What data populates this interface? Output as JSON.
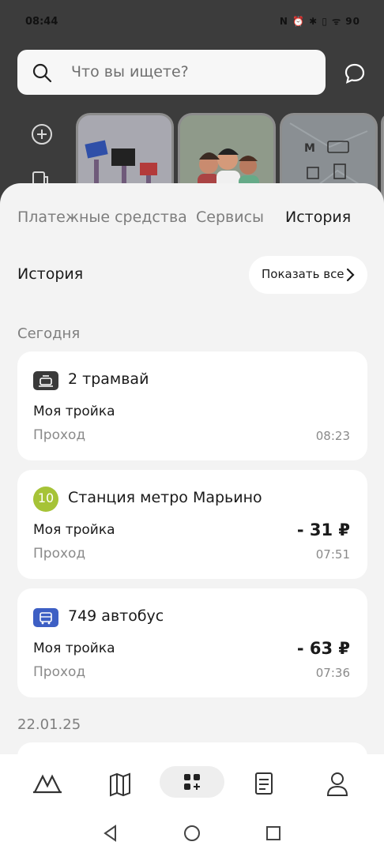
{
  "status_bar": {
    "time": "08:44",
    "icons_text": "N ⏰ ✱ ▯ ᯤ 90"
  },
  "search": {
    "placeholder": "Что вы ищете?"
  },
  "tabs": [
    {
      "label": "Платежные средства",
      "active": false
    },
    {
      "label": "Сервисы",
      "active": false
    },
    {
      "label": "История",
      "active": true
    }
  ],
  "history": {
    "title": "История",
    "show_all": "Показать все"
  },
  "groups": [
    {
      "date": "Сегодня",
      "items": [
        {
          "icon": "tram-icon",
          "badge_color": "#3a3a3a",
          "title": "2 трамвай",
          "line1": "Моя тройка",
          "line2": "Проход",
          "amount": "",
          "time": "08:23"
        },
        {
          "icon": "metro-line-10-icon",
          "badge_text": "10",
          "badge_color": "#a6c337",
          "title": "Станция метро Марьино",
          "line1": "Моя тройка",
          "line2": "Проход",
          "amount": "- 31 ₽",
          "time": "07:51"
        },
        {
          "icon": "bus-icon",
          "badge_color": "#3d5fc4",
          "title": "749 автобус",
          "line1": "Моя тройка",
          "line2": "Проход",
          "amount": "- 63 ₽",
          "time": "07:36"
        }
      ]
    },
    {
      "date": "22.01.25",
      "items": []
    }
  ],
  "bottom_nav": [
    "metro-logo-icon",
    "map-icon",
    "services-icon",
    "receipt-icon",
    "profile-icon"
  ],
  "colors": {
    "accent_metro": "#a6c337",
    "bus": "#3d5fc4",
    "tram": "#3a3a3a"
  }
}
